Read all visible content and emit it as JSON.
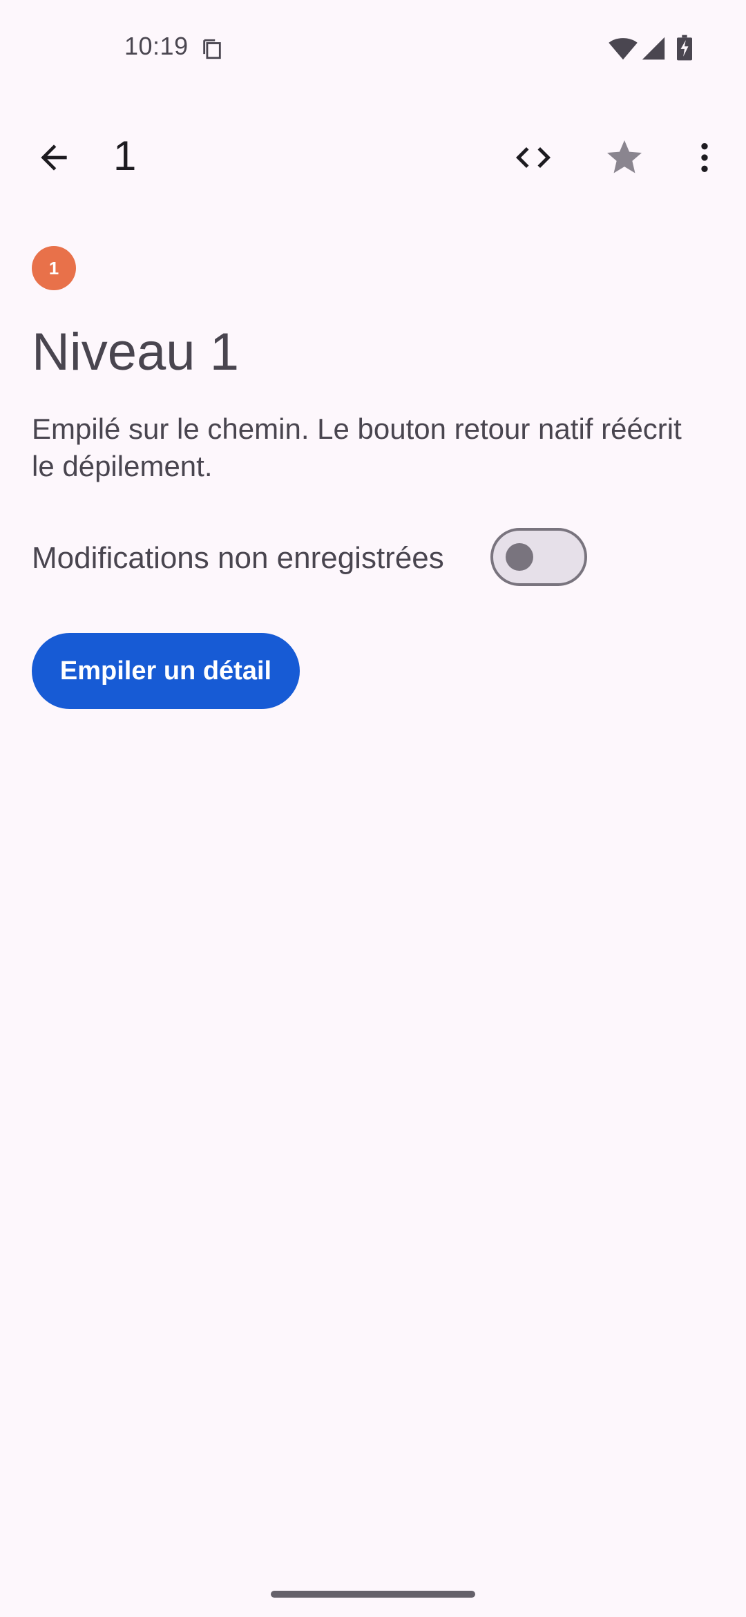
{
  "status_bar": {
    "time": "10:19",
    "icons": [
      "clipboard-icon",
      "wifi-icon",
      "signal-icon",
      "battery-charging-icon"
    ]
  },
  "app_bar": {
    "title": "1",
    "icons": [
      "back-arrow-icon",
      "code-icon",
      "star-icon",
      "more-vert-icon"
    ]
  },
  "content": {
    "badge": "1",
    "heading": "Niveau 1",
    "description": "Empilé sur le chemin. Le bouton retour natif réécrit le dépilement.",
    "toggle_label": "Modifications non enregistrées",
    "toggle_checked": false,
    "button_label": "Empiler un détail"
  },
  "colors": {
    "background": "#fdf7fc",
    "badge": "#e8714a",
    "primary_button": "#175bd5",
    "text": "#49454f"
  }
}
